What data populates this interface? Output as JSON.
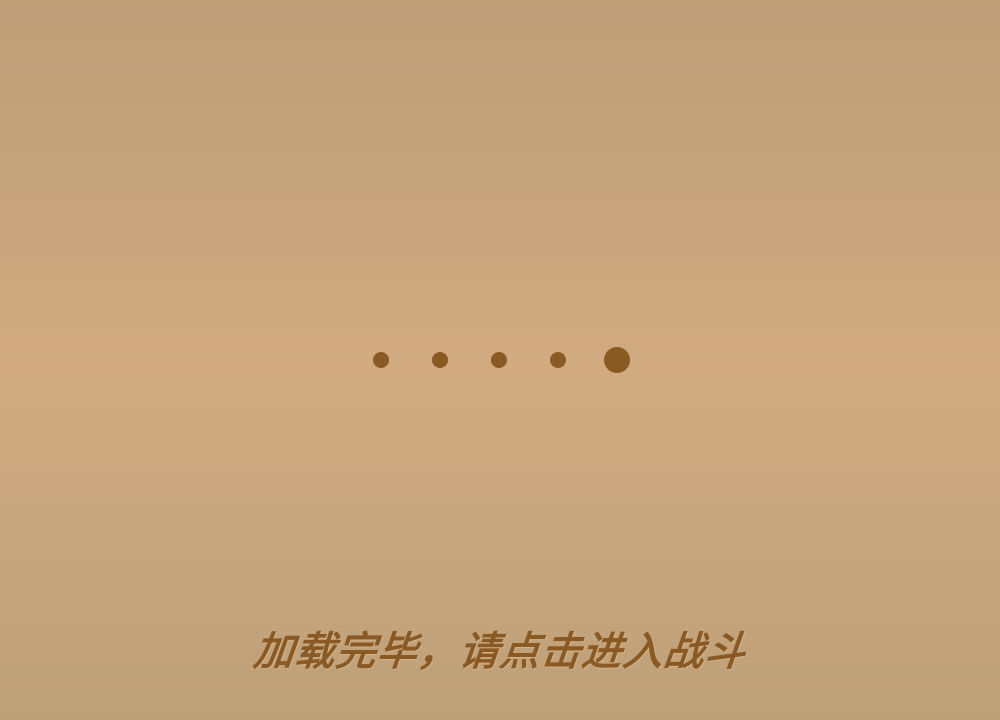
{
  "loading": {
    "total_steps": 5,
    "active_step": 5,
    "prompt_text": "加载完毕，请点击进入战斗"
  },
  "colors": {
    "background_center": "#d1aa80",
    "background_edge": "#bd9e77",
    "dot": "#8a5a24",
    "prompt": "#8b5a24"
  }
}
